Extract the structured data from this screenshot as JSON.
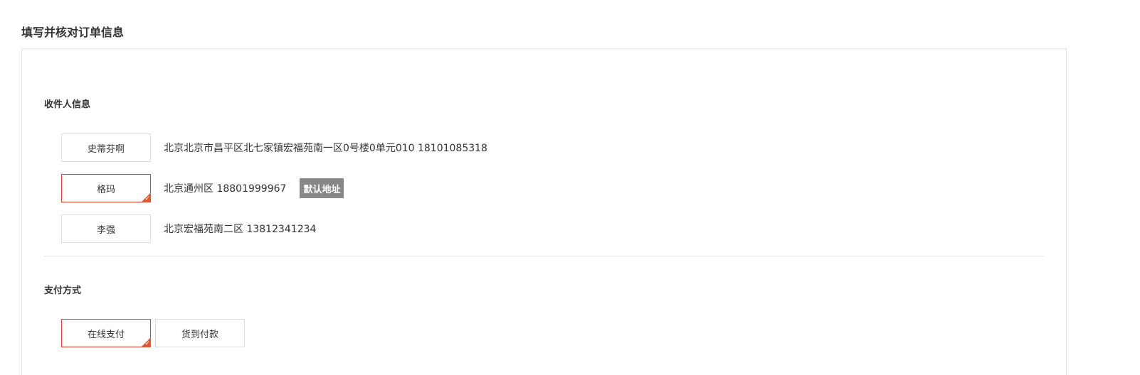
{
  "page": {
    "title": "填写并核对订单信息"
  },
  "recipient": {
    "section_title": "收件人信息",
    "items": [
      {
        "name": "史蒂芬啊",
        "address": "北京北京市昌平区北七家镇宏福苑南一区0号楼0单元010  18101085318",
        "selected": false,
        "badge": ""
      },
      {
        "name": "格玛",
        "address": "北京通州区  18801999967",
        "selected": true,
        "badge": "默认地址"
      },
      {
        "name": "李强",
        "address": "北京宏福苑南二区  13812341234",
        "selected": false,
        "badge": ""
      }
    ]
  },
  "payment": {
    "section_title": "支付方式",
    "options": [
      {
        "label": "在线支付",
        "selected": true
      },
      {
        "label": "货到付款",
        "selected": false
      }
    ]
  },
  "colors": {
    "selected_border": "#e33e33",
    "check_corner": "#e4572e",
    "badge_bg": "#878787",
    "border": "#dddddd"
  },
  "icons": {
    "selected_check": "check-icon"
  }
}
